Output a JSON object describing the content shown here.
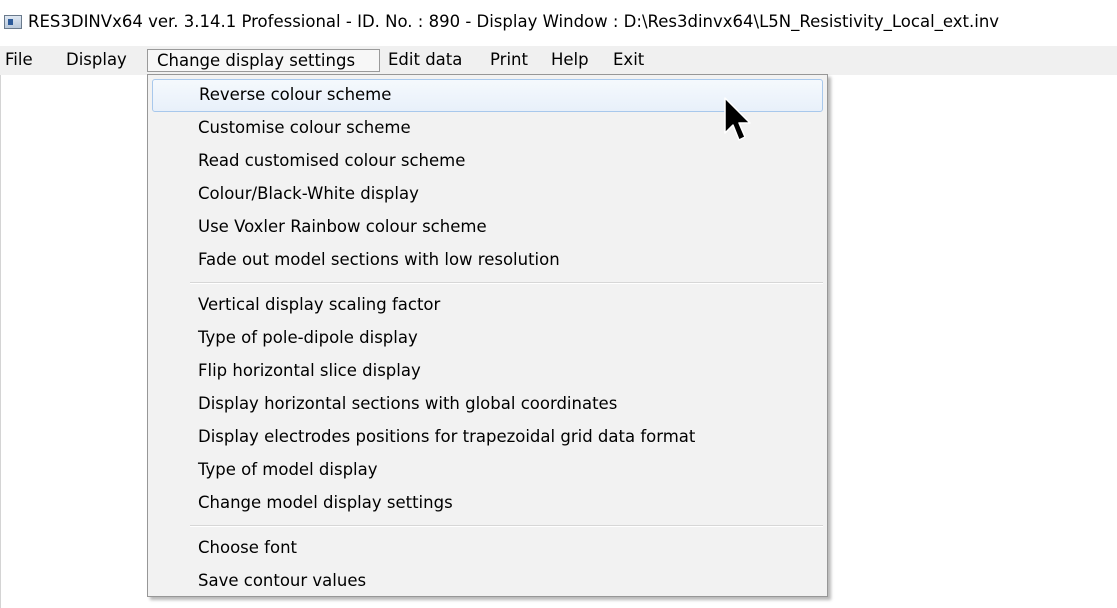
{
  "window": {
    "title": "RES3DINVx64 ver. 3.14.1 Professional - ID. No. : 890  - Display Window : D:\\Res3dinvx64\\L5N_Resistivity_Local_ext.inv",
    "icon": "application-window-icon"
  },
  "menubar": {
    "items": [
      {
        "label": "File"
      },
      {
        "label": "Display"
      },
      {
        "label": "Change display settings",
        "active": true
      },
      {
        "label": "Edit data"
      },
      {
        "label": "Print"
      },
      {
        "label": "Help"
      },
      {
        "label": "Exit"
      }
    ]
  },
  "dropdown": {
    "groups": [
      [
        {
          "label": "Reverse colour scheme",
          "highlighted": true
        },
        {
          "label": "Customise colour scheme"
        },
        {
          "label": "Read customised colour scheme"
        },
        {
          "label": "Colour/Black-White display"
        },
        {
          "label": "Use Voxler Rainbow colour scheme"
        },
        {
          "label": "Fade out model sections with low resolution"
        }
      ],
      [
        {
          "label": "Vertical display scaling factor"
        },
        {
          "label": "Type of pole-dipole display"
        },
        {
          "label": "Flip horizontal slice display"
        },
        {
          "label": "Display horizontal sections with global coordinates"
        },
        {
          "label": "Display electrodes positions for trapezoidal grid data format"
        },
        {
          "label": "Type of model display"
        },
        {
          "label": "Change model display settings"
        }
      ],
      [
        {
          "label": "Choose font"
        },
        {
          "label": "Save contour values"
        }
      ]
    ]
  },
  "colors": {
    "menubar_bg": "#f0f0f0",
    "dropdown_bg": "#f2f2f2",
    "highlight_border": "#a8c8ec"
  },
  "cursor": {
    "icon": "mouse-pointer-arrow-icon"
  }
}
